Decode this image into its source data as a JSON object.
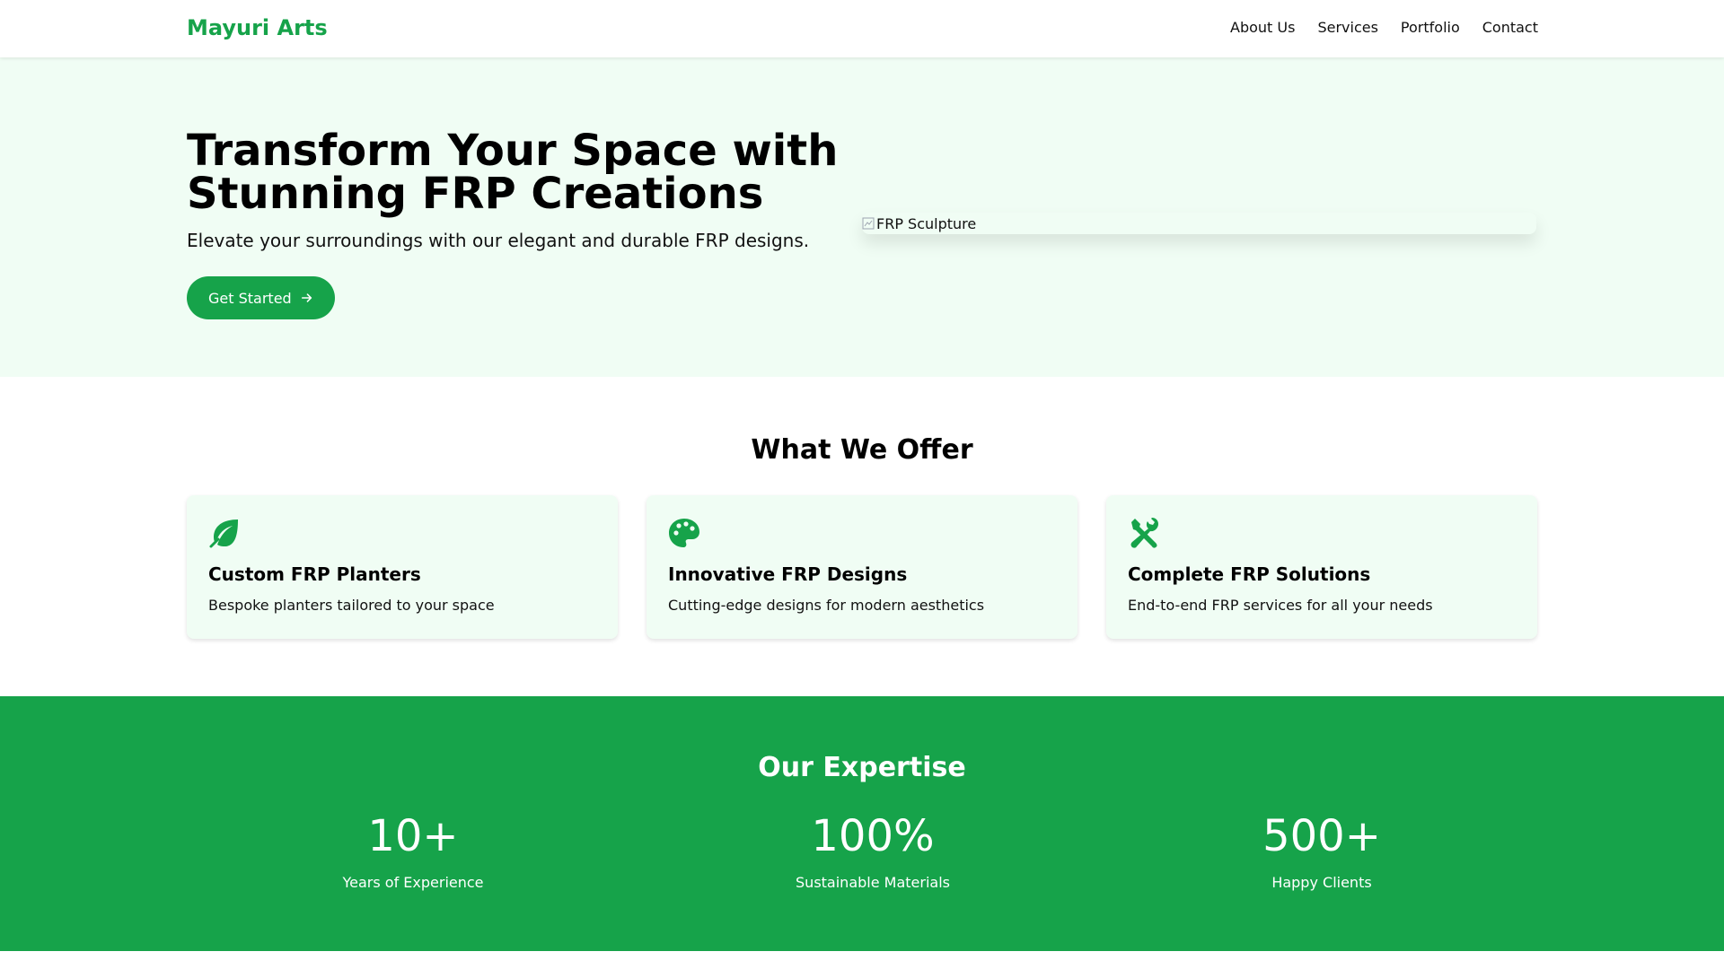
{
  "nav": {
    "brand": "Mayuri Arts",
    "links": [
      "About Us",
      "Services",
      "Portfolio",
      "Contact"
    ]
  },
  "hero": {
    "title": "Transform Your Space with Stunning FRP Creations",
    "subtitle": "Elevate your surroundings with our elegant and durable FRP designs.",
    "cta_label": "Get Started",
    "image_alt": "FRP Sculpture"
  },
  "offer": {
    "title": "What We Offer",
    "cards": [
      {
        "icon": "leaf-icon",
        "title": "Custom FRP Planters",
        "desc": "Bespoke planters tailored to your space"
      },
      {
        "icon": "palette-icon",
        "title": "Innovative FRP Designs",
        "desc": "Cutting-edge designs for modern aesthetics"
      },
      {
        "icon": "tools-icon",
        "title": "Complete FRP Solutions",
        "desc": "End-to-end FRP services for all your needs"
      }
    ]
  },
  "expertise": {
    "title": "Our Expertise",
    "stats": [
      {
        "value": "10+",
        "label": "Years of Experience"
      },
      {
        "value": "100%",
        "label": "Sustainable Materials"
      },
      {
        "value": "500+",
        "label": "Happy Clients"
      }
    ]
  },
  "colors": {
    "accent": "#16a34a",
    "light_bg": "#f0fdf4"
  }
}
